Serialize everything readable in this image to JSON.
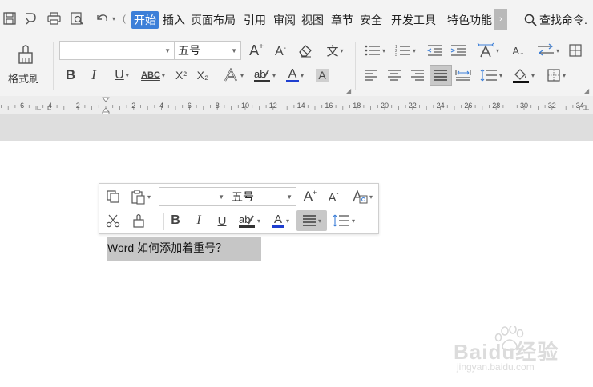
{
  "tabs": {
    "items": [
      "开始",
      "插入",
      "页面布局",
      "引用",
      "审阅",
      "视图",
      "章节",
      "安全",
      "开发工具",
      "特色功能"
    ],
    "active": "开始",
    "more": "›",
    "search_label": "查找命令."
  },
  "ribbon": {
    "format_painter_label": "格式刷",
    "font_name_value": "",
    "font_size_value": "五号",
    "abc_label": "ABC",
    "superscript_label": "X²",
    "subscript_label": "X₂",
    "bold_label": "B",
    "italic_label": "I",
    "underline_label": "U",
    "font_color_label": "A",
    "grow_label": "A",
    "shrink_label": "A",
    "phonetic_label": "文",
    "sort_label": "A↓"
  },
  "ruler": {
    "labels": [
      "6",
      "4",
      "2",
      "2",
      "4",
      "6",
      "8",
      "10",
      "12",
      "14",
      "16",
      "18",
      "20",
      "22",
      "24",
      "26",
      "28",
      "30",
      "32",
      "34",
      "36"
    ]
  },
  "mini_toolbar": {
    "font_name_value": "",
    "font_size_value": "五号",
    "bold_label": "B",
    "italic_label": "I",
    "underline_label": "U",
    "font_color_label": "A"
  },
  "document": {
    "selected_text": "Word 如何添加着重号？"
  },
  "watermark": {
    "brand": "Baidu经验",
    "url": "jingyan.baidu.com"
  },
  "colors": {
    "accent": "#3c7fd8",
    "font_color_bar": "#1f3fd0",
    "selection": "#c6c6c6"
  }
}
